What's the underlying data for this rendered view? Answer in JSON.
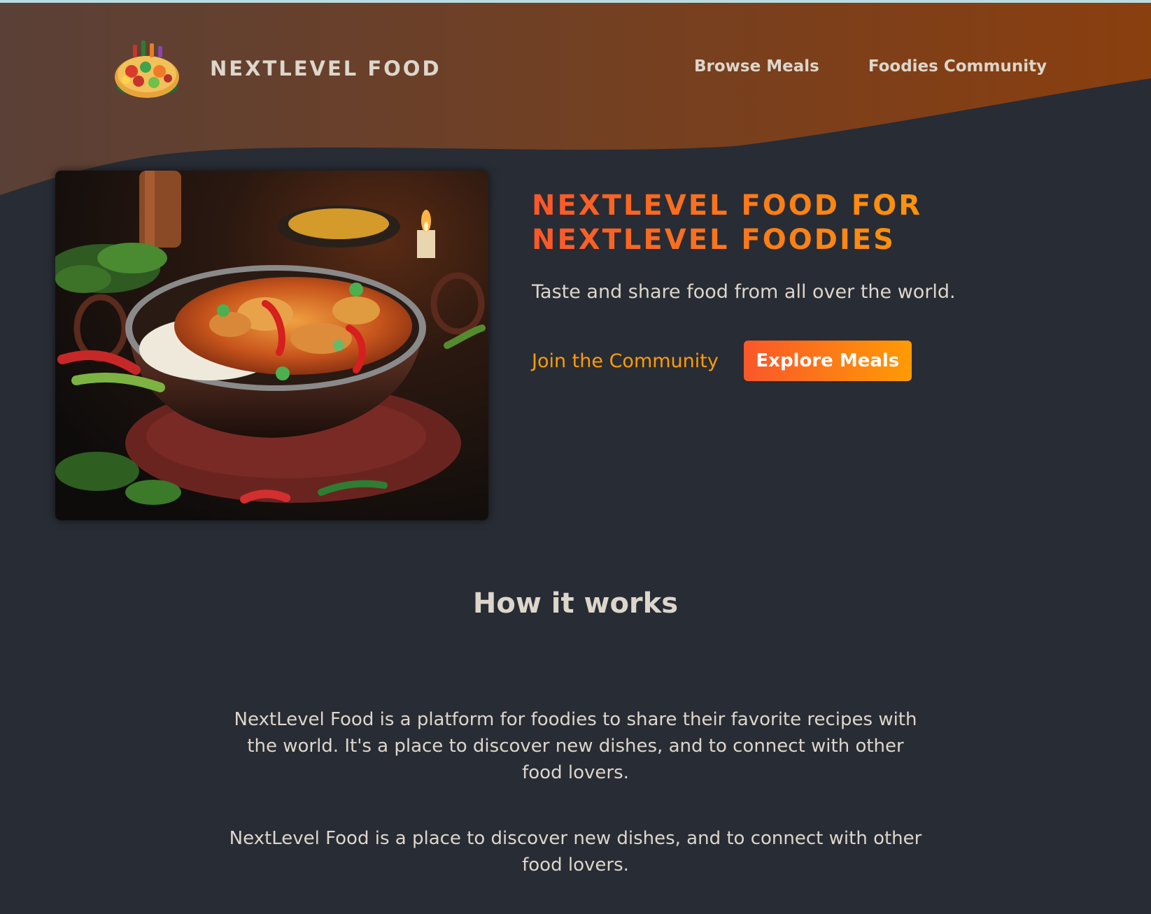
{
  "header": {
    "logo_text": "NextLevel Food",
    "nav": [
      {
        "label": "Browse Meals"
      },
      {
        "label": "Foodies Community"
      }
    ]
  },
  "hero": {
    "title": "NextLevel Food for NextLevel Foodies",
    "subtitle": "Taste and share food from all over the world.",
    "join_link": "Join the Community",
    "explore_button": "Explore Meals"
  },
  "how_it_works": {
    "heading": "How it works",
    "paragraph1": "NextLevel Food is a platform for foodies to share their favorite recipes with the world. It's a place to discover new dishes, and to connect with other food lovers.",
    "paragraph2": "NextLevel Food is a place to discover new dishes, and to connect with other food lovers."
  },
  "colors": {
    "background": "#282c34",
    "header_gradient_start": "#5a4037",
    "header_gradient_end": "#8a3f0f",
    "accent_start": "#f9572a",
    "accent_end": "#ff9b05",
    "text": "#ddd6cb"
  }
}
